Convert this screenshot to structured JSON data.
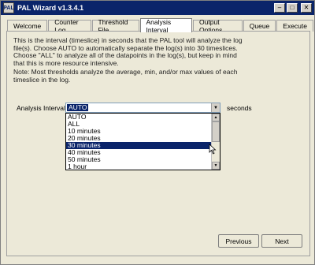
{
  "window": {
    "title": "PAL Wizard v1.3.4.1",
    "app_icon_text": "PAL"
  },
  "tabs": [
    {
      "label": "Welcome"
    },
    {
      "label": "Counter Log"
    },
    {
      "label": "Threshold File"
    },
    {
      "label": "Analysis Interval"
    },
    {
      "label": "Output Options"
    },
    {
      "label": "Queue"
    },
    {
      "label": "Execute"
    }
  ],
  "content": {
    "description": "This is the interval (timeslice) in seconds that the PAL tool will analyze the log file(s). Choose AUTO to automatically separate the log(s) into 30 timeslices. Choose \"ALL\" to analyze all of the datapoints in the log(s), but keep in mind that this is more resource intensive.",
    "note": "Note: Most thresholds analyze the average, min, and/or max values of each timeslice in the log.",
    "interval_label": "Analysis Interval:",
    "interval_value": "AUTO",
    "seconds_label": "seconds",
    "options": [
      {
        "label": "AUTO"
      },
      {
        "label": "ALL"
      },
      {
        "label": "10 minutes"
      },
      {
        "label": "20 minutes"
      },
      {
        "label": "30 minutes"
      },
      {
        "label": "40 minutes"
      },
      {
        "label": "50 minutes"
      },
      {
        "label": "1 hour"
      }
    ],
    "highlighted_option": "30 minutes"
  },
  "buttons": {
    "previous": "Previous",
    "next": "Next"
  },
  "colors": {
    "titlebar": "#0a246a",
    "selection": "#0a246a",
    "face": "#ece9d8"
  }
}
